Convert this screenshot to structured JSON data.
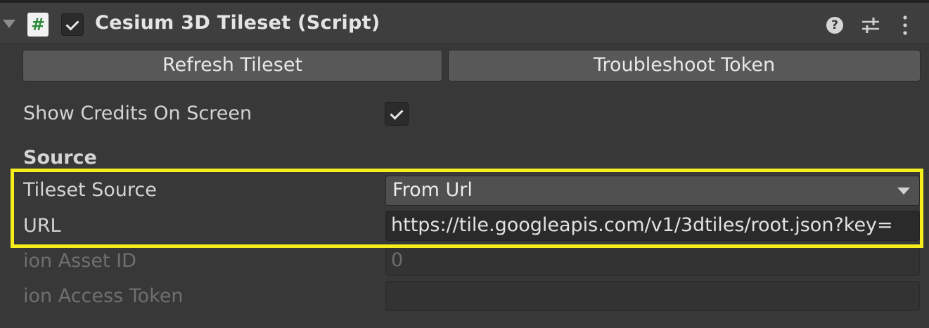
{
  "component": {
    "title": "Cesium 3D Tileset (Script)",
    "script_icon_glyph": "#",
    "enabled": true,
    "icons": [
      "foldout-arrow-icon",
      "script-icon",
      "help-icon",
      "presets-icon",
      "kebab-menu-icon"
    ]
  },
  "buttons": {
    "refresh_label": "Refresh Tileset",
    "troubleshoot_label": "Troubleshoot Token"
  },
  "fields": {
    "show_credits_label": "Show Credits On Screen",
    "show_credits_checked": true,
    "source_header": "Source",
    "tileset_source_label": "Tileset Source",
    "tileset_source_value": "From Url",
    "url_label": "URL",
    "url_value": "https://tile.googleapis.com/v1/3dtiles/root.json?key=",
    "ion_asset_id_label": "ion Asset ID",
    "ion_asset_id_value": "0",
    "ion_access_token_label": "ion Access Token",
    "ion_access_token_value": ""
  },
  "help_glyph": "?",
  "colors": {
    "background": "#383838",
    "highlight": "#f6ee1a",
    "button": "#585858",
    "field": "#2a2a2a"
  }
}
